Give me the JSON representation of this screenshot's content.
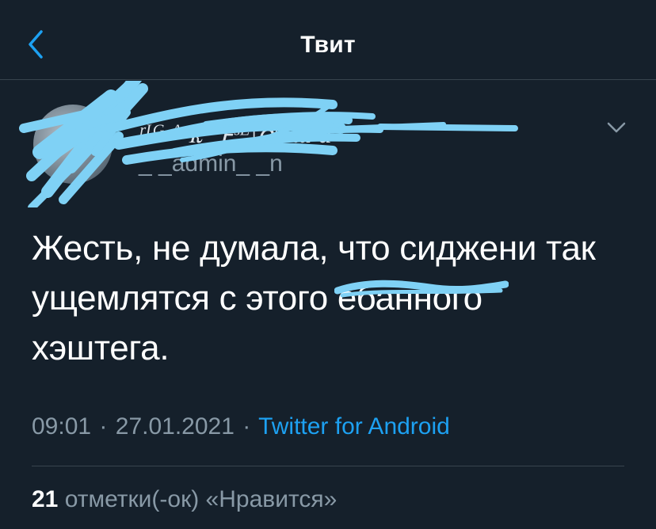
{
  "header": {
    "title": "Твит",
    "back_icon": "chevron-left-icon",
    "accent_color": "#1da1f2"
  },
  "author": {
    "display_name": "ʳᴵᴳ ᴬ ꭱᴮ ꜰˢᴱ|ꝺʳʳ ɯ ɗ'",
    "handle": "_ _admin_ _n",
    "avatar_icon": "avatar",
    "more_icon": "chevron-down-icon",
    "redaction_color": "#7fd1f5"
  },
  "tweet": {
    "line1": "Жесть, не думала, что сиджени так",
    "line2_before": "ущемлятся с этого",
    "line2_struck": "ебанного",
    "line3": "хэштега."
  },
  "meta": {
    "time": "09:01",
    "separator": "·",
    "date": "27.01.2021",
    "source": "Twitter for Android"
  },
  "likes": {
    "count": "21",
    "label": "отметки(-ок) «Нравится»"
  }
}
